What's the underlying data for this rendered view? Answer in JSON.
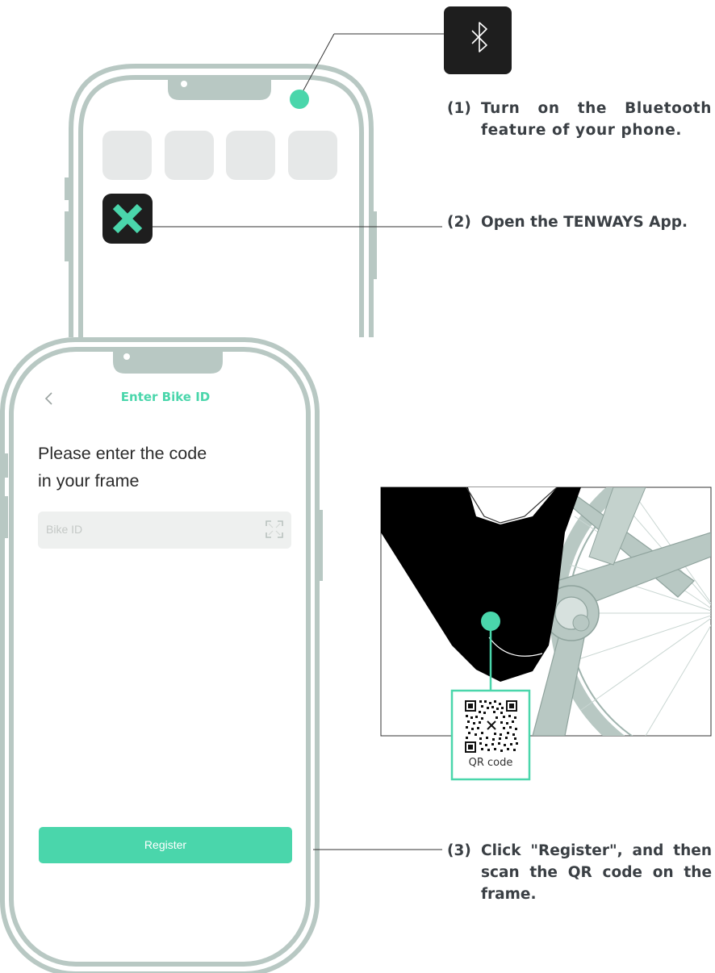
{
  "steps": [
    {
      "number": "(1)",
      "text": "Turn on the Bluetooth feature of your phone."
    },
    {
      "number": "(2)",
      "text": "Open the TENWAYS App."
    },
    {
      "number": "(3)",
      "text": "Click \"Register\", and then scan the QR code on the frame."
    }
  ],
  "app_screen": {
    "title": "Enter Bike ID",
    "prompt_line1": "Please enter the code",
    "prompt_line2": "in your frame",
    "input_placeholder": "Bike ID",
    "register_label": "Register"
  },
  "qr": {
    "caption": "QR code"
  },
  "colors": {
    "accent": "#4ad6ab",
    "phone_frame": "#b8c8c3",
    "text": "#3a3f44",
    "tile": "#e6e8e8",
    "dark": "#1e1e1e"
  },
  "icons": [
    "bluetooth-icon",
    "tenways-app-icon",
    "back-chevron-icon",
    "scan-icon",
    "qr-code-icon"
  ]
}
